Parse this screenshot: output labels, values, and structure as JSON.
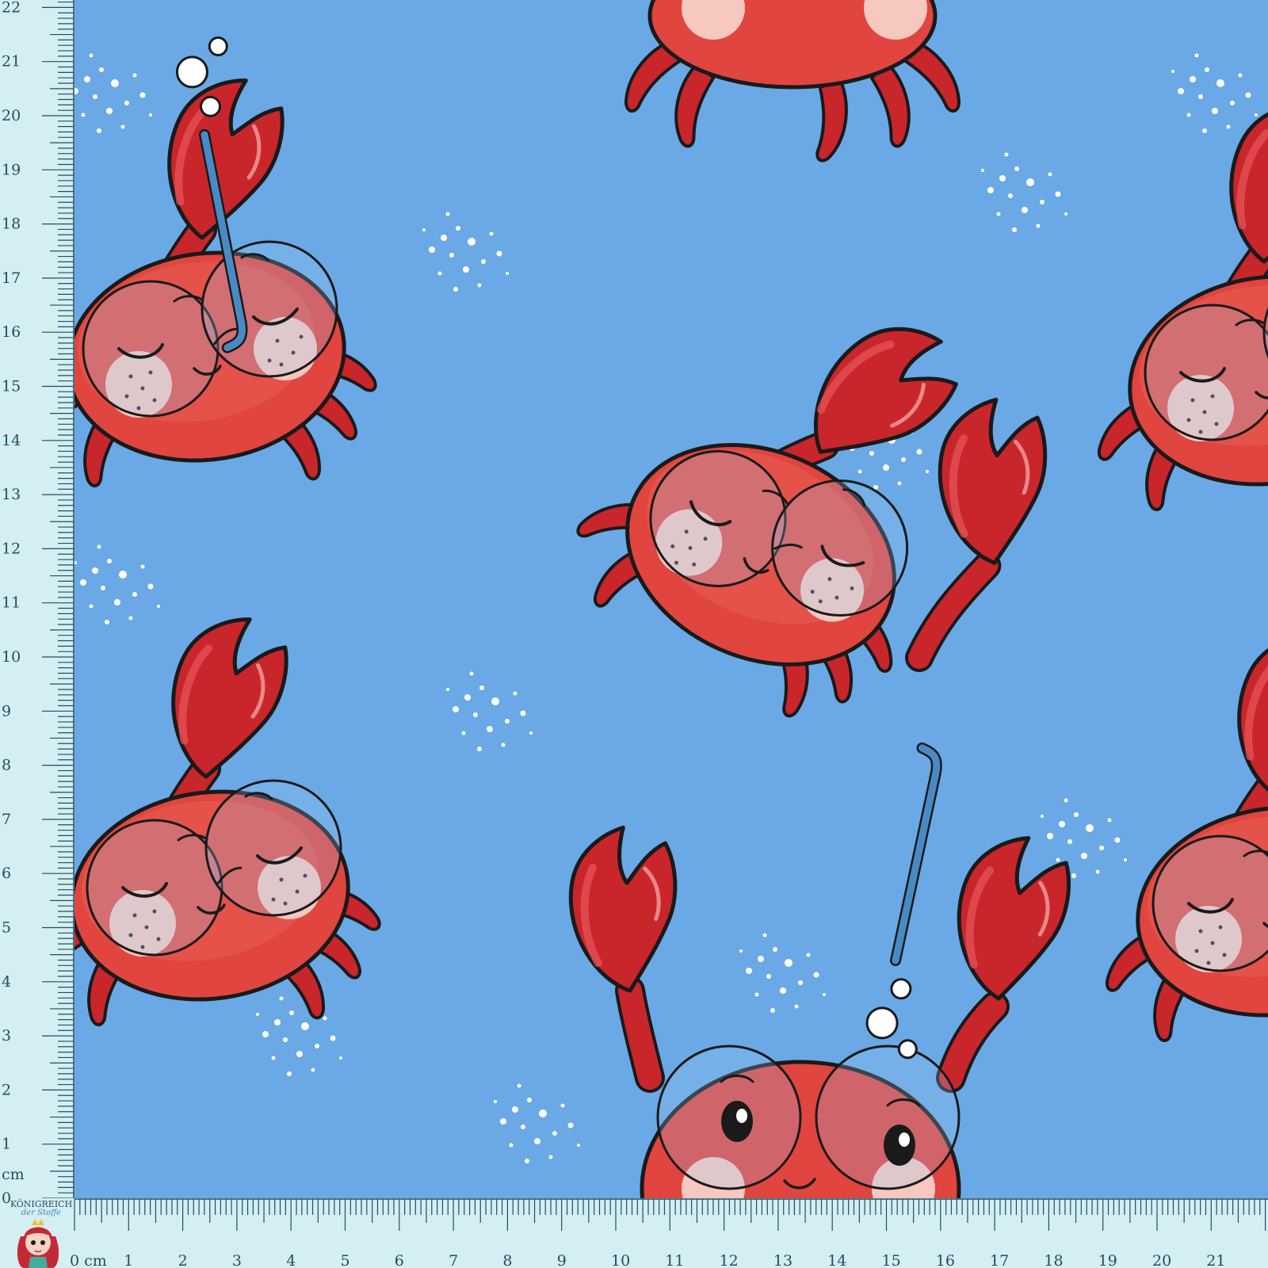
{
  "pattern": {
    "background_color": "#6aa9e6",
    "motif": "crab",
    "crab_color": "#e0453f",
    "crab_dark": "#c21f27",
    "outline_color": "#1a1a1a",
    "cheek_color": "#f6c8bf",
    "goggle_color": "#9cc8f0",
    "snorkel_color": "#4a8ac4"
  },
  "ruler": {
    "color": "#d4eef2",
    "tick_color": "#1f4e63",
    "unit_label": "cm",
    "x_labels": [
      "0 cm",
      "1",
      "2",
      "3",
      "4",
      "5",
      "6",
      "7",
      "8",
      "9",
      "10",
      "11",
      "12",
      "13",
      "14",
      "15",
      "16",
      "17",
      "18",
      "19",
      "20",
      "21"
    ],
    "y_labels": [
      "0",
      "1",
      "2",
      "3",
      "4",
      "5",
      "6",
      "7",
      "8",
      "9",
      "10",
      "11",
      "12",
      "13",
      "14",
      "15",
      "16",
      "17",
      "18",
      "19",
      "20",
      "21",
      "22"
    ]
  },
  "brand": {
    "name": "KÖNIGREICH",
    "sub": "der Stoffe",
    "mascot_icon": "mermaid-mascot-icon"
  }
}
